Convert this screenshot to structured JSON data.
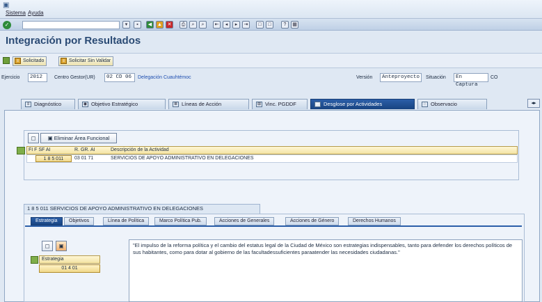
{
  "menu": {
    "items": [
      "Sistema",
      "Ayuda"
    ]
  },
  "page": {
    "title": "Integración por Resultados"
  },
  "appbar": {
    "solicitado": "Solicitado",
    "solicitar_sin_validar": "Solicitar Sin Validar"
  },
  "header": {
    "ejercicio_label": "Ejercicio",
    "ejercicio_value": "2012",
    "centro_label": "Centro Gestor(UR)",
    "centro_value": "02 CD 06",
    "centro_desc": "Delegación Cuauhtémoc",
    "version_label": "Versión",
    "version_value": "Anteproyecto",
    "situacion_label": "Situación",
    "situacion_value": "En Captura",
    "situacion_tail": "CO"
  },
  "tabs": [
    {
      "label": "Diagnóstico"
    },
    {
      "label": "Objetivo Estratégico"
    },
    {
      "label": "Líneas de Acción"
    },
    {
      "label": "Vinc. PGDDF"
    },
    {
      "label": "Desglose por Actividades"
    },
    {
      "label": "Observacio"
    }
  ],
  "area_funcional": {
    "eliminar_label": "Eliminar Área Funcional",
    "columns": [
      "FI F SF AI",
      "R. GR. AI",
      "Descripción de la Actividad"
    ],
    "rows": [
      {
        "fi": "1 8 5 011",
        "gr": "03 01 71",
        "desc": "SERVICIOS DE APOYO ADMINISTRATIVO EN DELEGACIONES"
      }
    ]
  },
  "detalle": {
    "title": "1 8 5 011  SERVICIOS DE APOYO ADMINISTRATIVO EN DELEGACIONES",
    "subtabs": [
      {
        "label": "Estrategia"
      },
      {
        "label": "Objetivos"
      },
      {
        "label": "Línea de Política"
      },
      {
        "label": "Marco Política Pub."
      },
      {
        "label": "Acciones de Generales"
      },
      {
        "label": "Acciones de Género"
      },
      {
        "label": "Derechos Humanos"
      }
    ],
    "estrategia_header": "Estrategia",
    "estrategia_value": "01 4 01",
    "texto": "\"El impulso de la reforma política y el cambio del estatus legal de la Ciudad de México son estrategias indispensables, tanto para defender los derechos políticos de sus habitantes, como para dotar al gobierno de las facultadessuficientes paraatender las necesidades ciudadanas.\""
  },
  "colors": {
    "accent": "#184481",
    "title": "#2a4a74",
    "grid_header": "#f3e3a4"
  }
}
